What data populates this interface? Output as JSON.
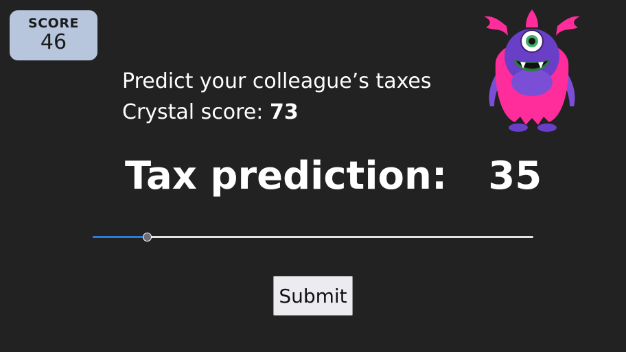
{
  "score": {
    "label": "SCORE",
    "value": "46"
  },
  "prompt": {
    "line1": "Predict your colleague’s taxes",
    "crystal_label": "Crystal score:",
    "crystal_value": "73"
  },
  "prediction": {
    "label": "Tax prediction:",
    "value": "35"
  },
  "slider": {
    "fraction": 0.125
  },
  "submit": {
    "label": "Submit"
  },
  "colors": {
    "background": "#222222",
    "score_box": "#b7c5dd",
    "slider_fill": "#2d7bdc",
    "monster_pink": "#ff2d9b",
    "monster_purple": "#6a3fc8"
  }
}
